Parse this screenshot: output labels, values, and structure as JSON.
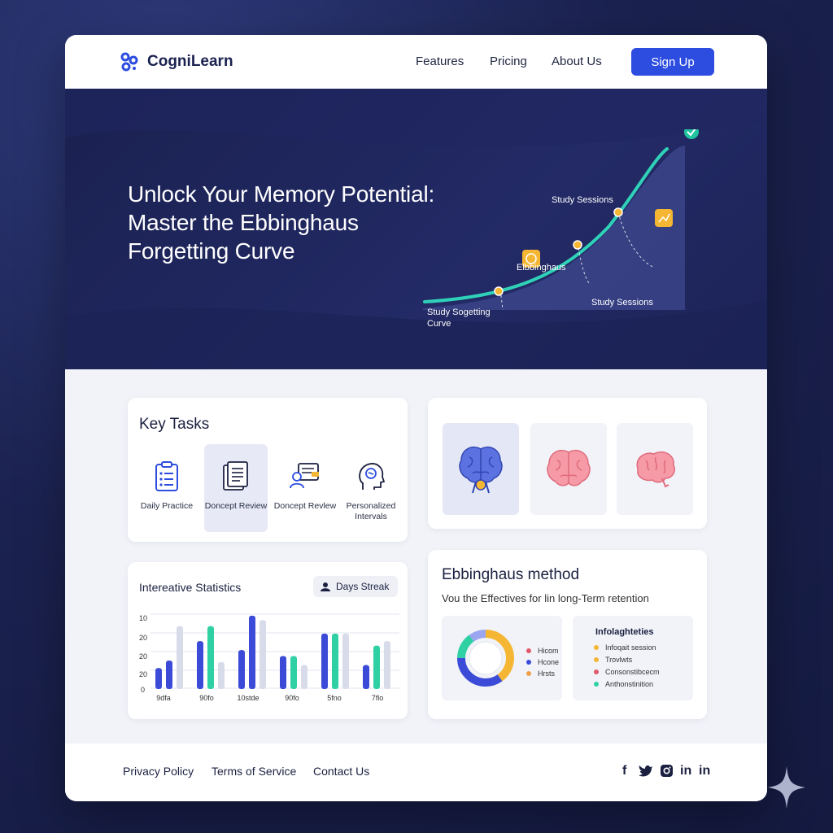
{
  "header": {
    "brand": "CogniLearn",
    "nav": [
      "Features",
      "Pricing",
      "About Us"
    ],
    "signup_label": "Sign Up"
  },
  "hero": {
    "title_lines": [
      "Unlock Your Memory Potential:",
      "Master the Ebbinghaus",
      "Forgetting Curve"
    ],
    "curve_labels": {
      "top": "Study Sessions",
      "middle": "Elbbinghaus",
      "right": "Study Sessions",
      "bottom_line1": "Study Sogetting",
      "bottom_line2": "Curve"
    }
  },
  "tasks": {
    "title": "Key Tasks",
    "items": [
      {
        "label": "Daily Practice",
        "icon": "clipboard-icon"
      },
      {
        "label": "Doncept Review",
        "icon": "document-stack-icon"
      },
      {
        "label": "Doncept Revlew",
        "icon": "person-review-icon"
      },
      {
        "label": "Personalized Intervals",
        "icon": "brain-head-icon"
      }
    ],
    "active_index": 1
  },
  "brains": {
    "tiles": [
      "brain-medal-icon",
      "brain-icon",
      "brain-icon"
    ],
    "colors": [
      "#5b72e0",
      "#f08a9a",
      "#f08a9a"
    ]
  },
  "stats": {
    "title": "Intereative Statistics",
    "streak_label": "Days Streak",
    "y_ticks": [
      "10",
      "20",
      "20",
      "20",
      "0"
    ],
    "x_ticks": [
      "9dfa",
      "90fo",
      "10stde",
      "90fo",
      "5fno",
      "7flo"
    ]
  },
  "chart_data": {
    "type": "bar",
    "categories": [
      "9dfa",
      "90fo",
      "10stde",
      "90fo",
      "5fno",
      "7flo"
    ],
    "series": [
      {
        "color": "#3b4bd8",
        "values": [
          14,
          32,
          26,
          22,
          37,
          16
        ]
      },
      {
        "color": "#3b4bd8",
        "values": [
          19,
          0,
          49,
          0,
          0,
          0
        ]
      },
      {
        "color": "#2fd1a4",
        "values": [
          0,
          42,
          0,
          22,
          37,
          29
        ]
      },
      {
        "color": "#d8dcea",
        "values": [
          42,
          18,
          46,
          16,
          37,
          32
        ]
      }
    ],
    "y_ticks": [
      "10",
      "20",
      "20",
      "20",
      "0"
    ],
    "grid": true
  },
  "method": {
    "title": "Ebbinghaus method",
    "subtitle": "Vou the Effectives for lin long-Term retention",
    "donut_legend": [
      {
        "label": "Hicom",
        "color": "#e05a6a"
      },
      {
        "label": "Hcone",
        "color": "#3b4bd8"
      },
      {
        "label": "Hrsts",
        "color": "#f0a24a"
      }
    ],
    "donut_segments": [
      {
        "color": "#f5b634",
        "value": 40
      },
      {
        "color": "#3b4bd8",
        "value": 35
      },
      {
        "color": "#2fd1a4",
        "value": 15
      },
      {
        "color": "#9aa6f0",
        "value": 10
      }
    ],
    "list_title": "Infolaghteties",
    "list_items": [
      {
        "label": "Infoqait session",
        "color": "#f5b634"
      },
      {
        "label": "Trovlwts",
        "color": "#f5b634"
      },
      {
        "label": "Consonstibcecm",
        "color": "#e05a6a"
      },
      {
        "label": "Anthonstinition",
        "color": "#2fd1a4"
      }
    ]
  },
  "footer": {
    "links": [
      "Privacy Policy",
      "Terms of Service",
      "Contact Us"
    ],
    "social": [
      "facebook-icon",
      "twitter-icon",
      "instagram-icon",
      "linkedin-icon",
      "linkedin-icon"
    ]
  }
}
